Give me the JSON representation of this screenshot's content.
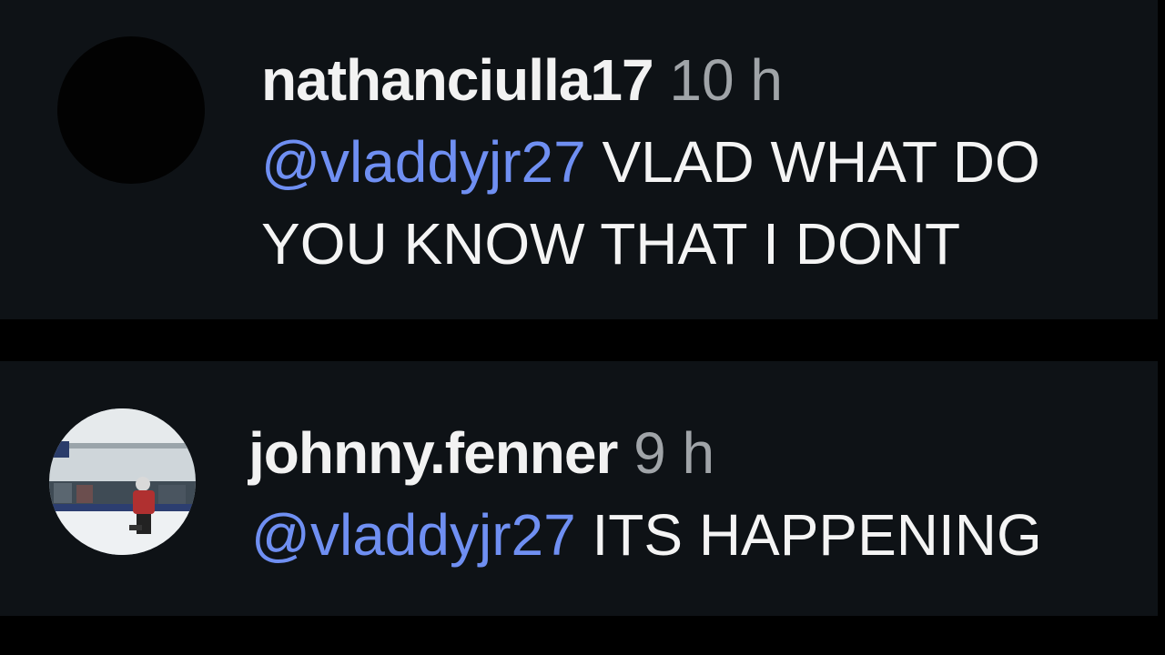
{
  "comments": [
    {
      "username": "nathanciulla17",
      "time": "10 h",
      "mention": "@vladdyjr27",
      "text": "VLAD WHAT DO YOU KNOW THAT I DONT"
    },
    {
      "username": "johnny.fenner",
      "time": "9 h",
      "mention": "@vladdyjr27",
      "text": "ITS HAPPENING"
    }
  ],
  "colors": {
    "background": "#000000",
    "card": "#0e1216",
    "mention": "#6f8ff2",
    "username": "#f2f2f2",
    "time": "#a0a4a8"
  }
}
